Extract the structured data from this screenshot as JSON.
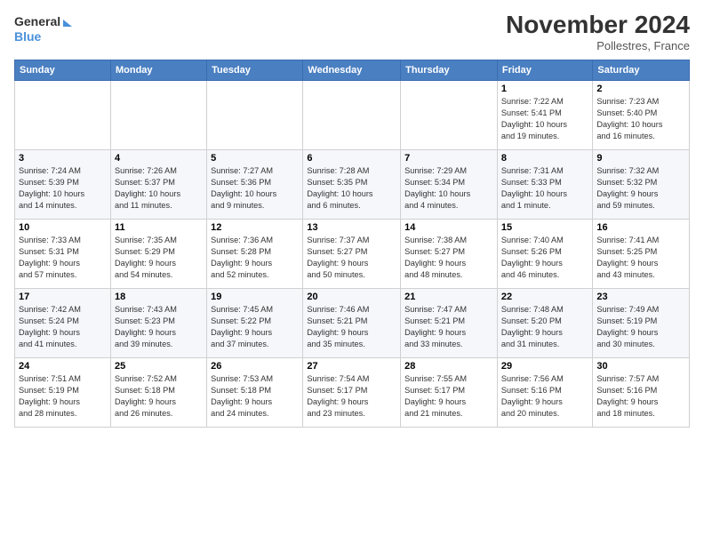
{
  "logo": {
    "line1": "General",
    "line2": "Blue"
  },
  "title": "November 2024",
  "location": "Pollestres, France",
  "columns": [
    "Sunday",
    "Monday",
    "Tuesday",
    "Wednesday",
    "Thursday",
    "Friday",
    "Saturday"
  ],
  "weeks": [
    [
      {
        "day": "",
        "info": ""
      },
      {
        "day": "",
        "info": ""
      },
      {
        "day": "",
        "info": ""
      },
      {
        "day": "",
        "info": ""
      },
      {
        "day": "",
        "info": ""
      },
      {
        "day": "1",
        "info": "Sunrise: 7:22 AM\nSunset: 5:41 PM\nDaylight: 10 hours\nand 19 minutes."
      },
      {
        "day": "2",
        "info": "Sunrise: 7:23 AM\nSunset: 5:40 PM\nDaylight: 10 hours\nand 16 minutes."
      }
    ],
    [
      {
        "day": "3",
        "info": "Sunrise: 7:24 AM\nSunset: 5:39 PM\nDaylight: 10 hours\nand 14 minutes."
      },
      {
        "day": "4",
        "info": "Sunrise: 7:26 AM\nSunset: 5:37 PM\nDaylight: 10 hours\nand 11 minutes."
      },
      {
        "day": "5",
        "info": "Sunrise: 7:27 AM\nSunset: 5:36 PM\nDaylight: 10 hours\nand 9 minutes."
      },
      {
        "day": "6",
        "info": "Sunrise: 7:28 AM\nSunset: 5:35 PM\nDaylight: 10 hours\nand 6 minutes."
      },
      {
        "day": "7",
        "info": "Sunrise: 7:29 AM\nSunset: 5:34 PM\nDaylight: 10 hours\nand 4 minutes."
      },
      {
        "day": "8",
        "info": "Sunrise: 7:31 AM\nSunset: 5:33 PM\nDaylight: 10 hours\nand 1 minute."
      },
      {
        "day": "9",
        "info": "Sunrise: 7:32 AM\nSunset: 5:32 PM\nDaylight: 9 hours\nand 59 minutes."
      }
    ],
    [
      {
        "day": "10",
        "info": "Sunrise: 7:33 AM\nSunset: 5:31 PM\nDaylight: 9 hours\nand 57 minutes."
      },
      {
        "day": "11",
        "info": "Sunrise: 7:35 AM\nSunset: 5:29 PM\nDaylight: 9 hours\nand 54 minutes."
      },
      {
        "day": "12",
        "info": "Sunrise: 7:36 AM\nSunset: 5:28 PM\nDaylight: 9 hours\nand 52 minutes."
      },
      {
        "day": "13",
        "info": "Sunrise: 7:37 AM\nSunset: 5:27 PM\nDaylight: 9 hours\nand 50 minutes."
      },
      {
        "day": "14",
        "info": "Sunrise: 7:38 AM\nSunset: 5:27 PM\nDaylight: 9 hours\nand 48 minutes."
      },
      {
        "day": "15",
        "info": "Sunrise: 7:40 AM\nSunset: 5:26 PM\nDaylight: 9 hours\nand 46 minutes."
      },
      {
        "day": "16",
        "info": "Sunrise: 7:41 AM\nSunset: 5:25 PM\nDaylight: 9 hours\nand 43 minutes."
      }
    ],
    [
      {
        "day": "17",
        "info": "Sunrise: 7:42 AM\nSunset: 5:24 PM\nDaylight: 9 hours\nand 41 minutes."
      },
      {
        "day": "18",
        "info": "Sunrise: 7:43 AM\nSunset: 5:23 PM\nDaylight: 9 hours\nand 39 minutes."
      },
      {
        "day": "19",
        "info": "Sunrise: 7:45 AM\nSunset: 5:22 PM\nDaylight: 9 hours\nand 37 minutes."
      },
      {
        "day": "20",
        "info": "Sunrise: 7:46 AM\nSunset: 5:21 PM\nDaylight: 9 hours\nand 35 minutes."
      },
      {
        "day": "21",
        "info": "Sunrise: 7:47 AM\nSunset: 5:21 PM\nDaylight: 9 hours\nand 33 minutes."
      },
      {
        "day": "22",
        "info": "Sunrise: 7:48 AM\nSunset: 5:20 PM\nDaylight: 9 hours\nand 31 minutes."
      },
      {
        "day": "23",
        "info": "Sunrise: 7:49 AM\nSunset: 5:19 PM\nDaylight: 9 hours\nand 30 minutes."
      }
    ],
    [
      {
        "day": "24",
        "info": "Sunrise: 7:51 AM\nSunset: 5:19 PM\nDaylight: 9 hours\nand 28 minutes."
      },
      {
        "day": "25",
        "info": "Sunrise: 7:52 AM\nSunset: 5:18 PM\nDaylight: 9 hours\nand 26 minutes."
      },
      {
        "day": "26",
        "info": "Sunrise: 7:53 AM\nSunset: 5:18 PM\nDaylight: 9 hours\nand 24 minutes."
      },
      {
        "day": "27",
        "info": "Sunrise: 7:54 AM\nSunset: 5:17 PM\nDaylight: 9 hours\nand 23 minutes."
      },
      {
        "day": "28",
        "info": "Sunrise: 7:55 AM\nSunset: 5:17 PM\nDaylight: 9 hours\nand 21 minutes."
      },
      {
        "day": "29",
        "info": "Sunrise: 7:56 AM\nSunset: 5:16 PM\nDaylight: 9 hours\nand 20 minutes."
      },
      {
        "day": "30",
        "info": "Sunrise: 7:57 AM\nSunset: 5:16 PM\nDaylight: 9 hours\nand 18 minutes."
      }
    ]
  ]
}
